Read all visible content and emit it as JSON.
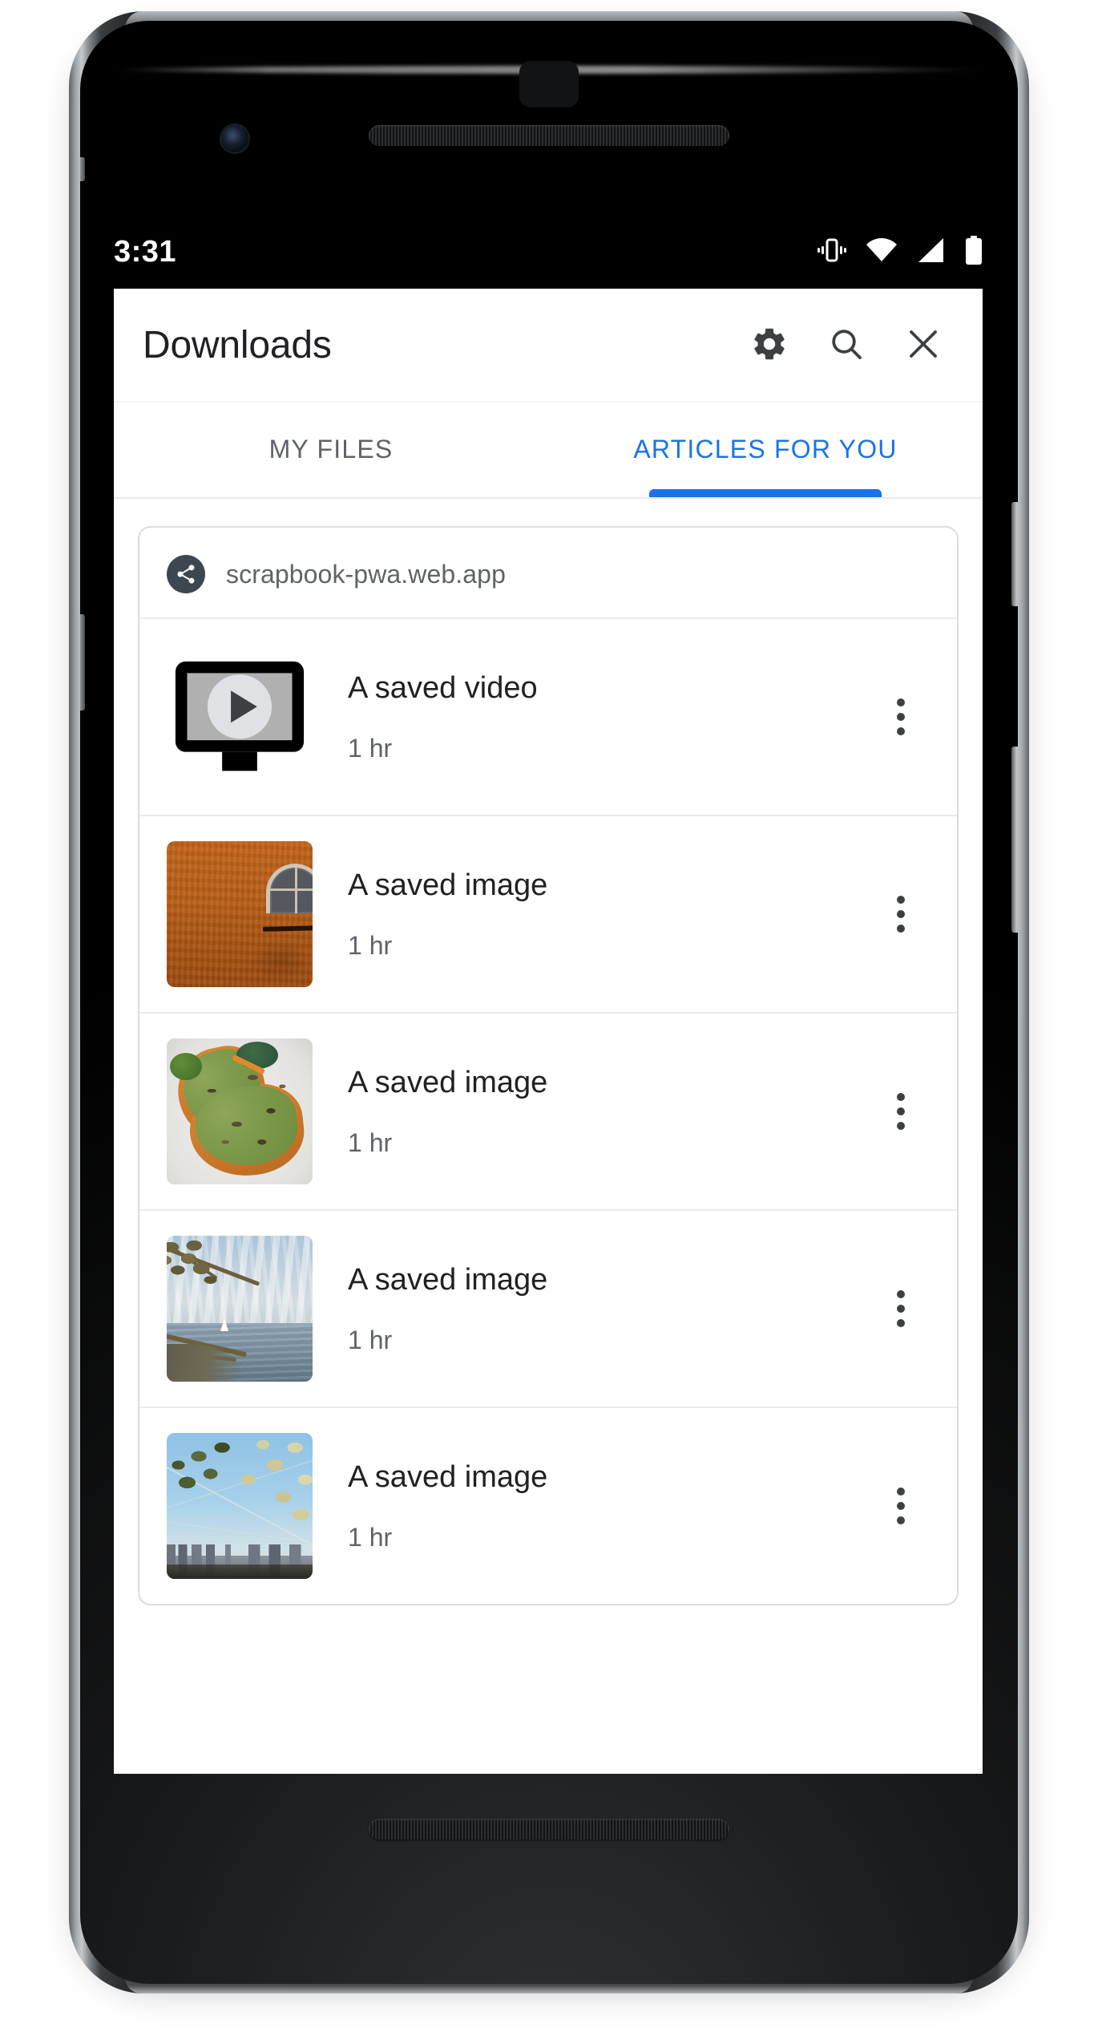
{
  "statusbar": {
    "clock": "3:31",
    "icons": [
      "vibrate-icon",
      "wifi-icon",
      "cellular-signal-icon",
      "battery-icon"
    ]
  },
  "appbar": {
    "title": "Downloads",
    "actions": [
      {
        "name": "settings-button",
        "icon": "gear-icon"
      },
      {
        "name": "search-button",
        "icon": "search-icon"
      },
      {
        "name": "close-button",
        "icon": "close-icon"
      }
    ]
  },
  "tabs": {
    "active_index": 1,
    "active_color": "#1a73e8",
    "inactive_color": "#5f6368",
    "items": [
      {
        "label": "MY FILES",
        "active": false
      },
      {
        "label": "ARTICLES FOR YOU",
        "active": true
      }
    ]
  },
  "card": {
    "source_icon": "share-icon",
    "source_badge_color": "#3c4750",
    "domain": "scrapbook-pwa.web.app",
    "items": [
      {
        "title": "A saved video",
        "subtitle": "1 hr",
        "thumb": "video-placeholder-icon",
        "menu": "more-options-icon"
      },
      {
        "title": "A saved image",
        "subtitle": "1 hr",
        "thumb": "photo-orange-wall",
        "menu": "more-options-icon"
      },
      {
        "title": "A saved image",
        "subtitle": "1 hr",
        "thumb": "photo-avocado-toast",
        "menu": "more-options-icon"
      },
      {
        "title": "A saved image",
        "subtitle": "1 hr",
        "thumb": "photo-lake-sailboat",
        "menu": "more-options-icon"
      },
      {
        "title": "A saved image",
        "subtitle": "1 hr",
        "thumb": "photo-city-blossoms",
        "menu": "more-options-icon"
      }
    ]
  },
  "device": {
    "hardware": [
      "front-camera",
      "earpiece-speaker",
      "bottom-speaker",
      "power-button",
      "volume-button"
    ]
  }
}
